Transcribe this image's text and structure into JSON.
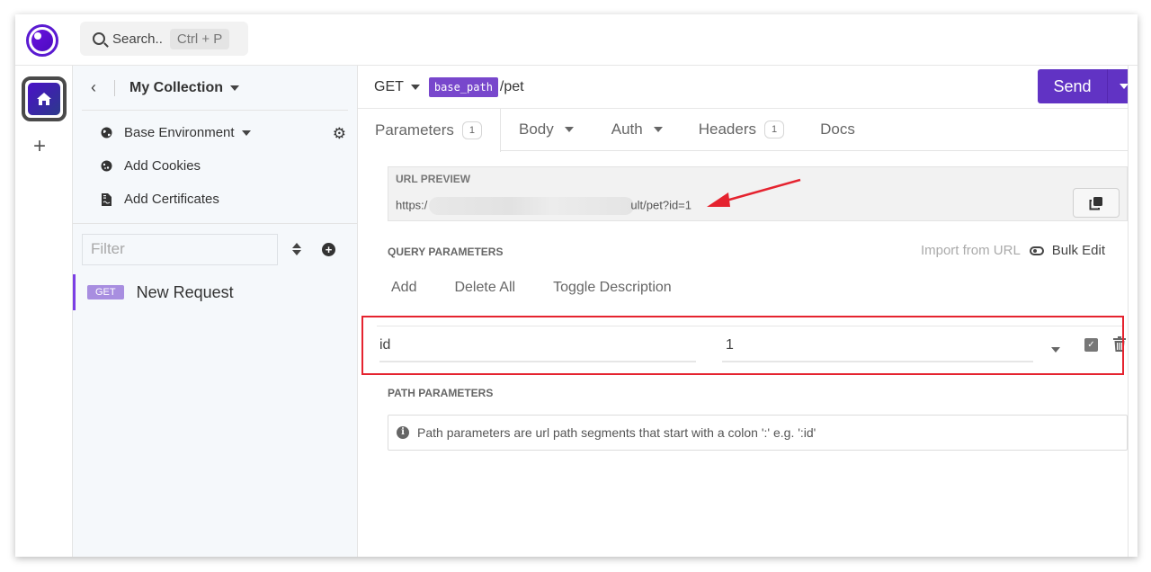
{
  "topbar": {
    "search_placeholder": "Search..",
    "search_shortcut": "Ctrl + P"
  },
  "sidebar": {
    "collection_title": "My Collection",
    "environment": "Base Environment",
    "items": [
      {
        "label": "Add Cookies",
        "icon": "cookie-icon"
      },
      {
        "label": "Add Certificates",
        "icon": "certificate-icon"
      }
    ],
    "filter_placeholder": "Filter",
    "requests": [
      {
        "method": "GET",
        "name": "New Request"
      }
    ]
  },
  "request": {
    "method": "GET",
    "env_variable": "base_path",
    "path": "/pet",
    "send_label": "Send"
  },
  "tabs": [
    {
      "label": "Parameters",
      "count": "1",
      "active": true
    },
    {
      "label": "Body",
      "dropdown": true
    },
    {
      "label": "Auth",
      "dropdown": true
    },
    {
      "label": "Headers",
      "count": "1"
    },
    {
      "label": "Docs"
    }
  ],
  "url_preview": {
    "label": "URL PREVIEW",
    "prefix": "https:/",
    "suffix": "ult/pet?id=1"
  },
  "query_parameters": {
    "heading": "QUERY PARAMETERS",
    "import_label": "Import from URL",
    "bulk_edit_label": "Bulk Edit",
    "actions": [
      "Add",
      "Delete All",
      "Toggle Description"
    ],
    "rows": [
      {
        "key": "id",
        "value": "1",
        "enabled": true
      }
    ]
  },
  "path_parameters": {
    "heading": "PATH PARAMETERS",
    "info": "Path parameters are url path segments that start with a colon ':' e.g. ':id'"
  },
  "colors": {
    "accent": "#6133c4",
    "annotation_red": "#e5232f",
    "get_badge": "#a88ee0"
  }
}
